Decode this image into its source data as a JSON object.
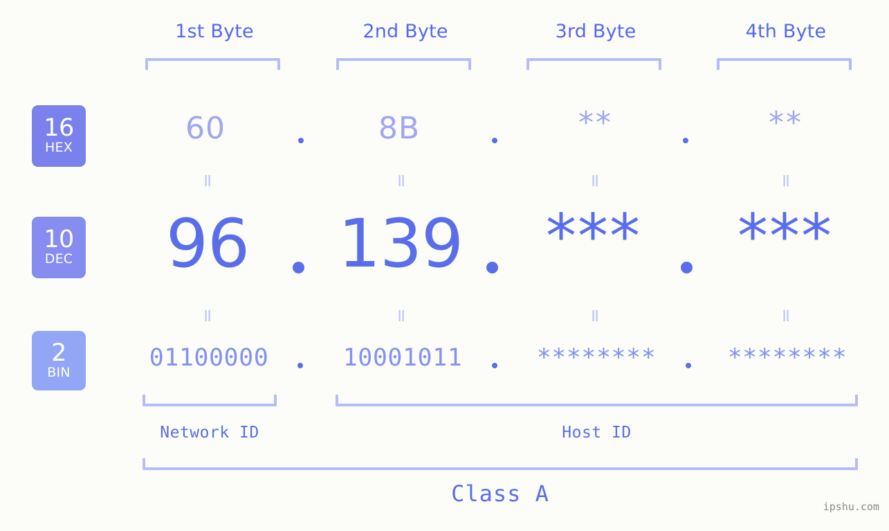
{
  "theme": {
    "background": "#fcfdf8",
    "accent_strong": "#5a6ee9",
    "accent_header": "#5468ea",
    "accent_hex": "#9fa7f0",
    "accent_bin": "#8491f1",
    "bracket": "#b6bdf6",
    "equals": "#bcc4f7",
    "badge_hex_bg": "#7b81ec",
    "badge_dec_bg": "#868cf0",
    "badge_bin_bg": "#93a5f5",
    "watermark_color": "#8a8a8a"
  },
  "headers": {
    "byte1": "1st Byte",
    "byte2": "2nd Byte",
    "byte3": "3rd Byte",
    "byte4": "4th Byte"
  },
  "bases": {
    "hex": {
      "number": "16",
      "label": "HEX"
    },
    "dec": {
      "number": "10",
      "label": "DEC"
    },
    "bin": {
      "number": "2",
      "label": "BIN"
    }
  },
  "rows": {
    "hex": {
      "byte1": "60",
      "byte2": "8B",
      "byte3": "**",
      "byte4": "**",
      "sep1": ".",
      "sep2": ".",
      "sep3": "."
    },
    "dec": {
      "byte1": "96",
      "byte2": "139",
      "byte3": "***",
      "byte4": "***",
      "sep1": ".",
      "sep2": ".",
      "sep3": "."
    },
    "bin": {
      "byte1": "01100000",
      "byte2": "10001011",
      "byte3": "********",
      "byte4": "********",
      "sep1": ".",
      "sep2": ".",
      "sep3": "."
    }
  },
  "equals_marks": {
    "hex_to_dec_1": "=",
    "hex_to_dec_2": "=",
    "hex_to_dec_3": "=",
    "hex_to_dec_4": "=",
    "dec_to_bin_1": "=",
    "dec_to_bin_2": "=",
    "dec_to_bin_3": "=",
    "dec_to_bin_4": "="
  },
  "segments": {
    "network_id": "Network ID",
    "host_id": "Host ID",
    "ip_class": "Class A"
  },
  "watermark": "ipshu.com",
  "chart_data": {
    "type": "table",
    "title": "IPv4 address byte breakdown",
    "columns": [
      "1st Byte",
      "2nd Byte",
      "3rd Byte",
      "4th Byte"
    ],
    "rows": [
      {
        "base": "16",
        "base_label": "HEX",
        "values": [
          "60",
          "8B",
          "**",
          "**"
        ]
      },
      {
        "base": "10",
        "base_label": "DEC",
        "values": [
          "96",
          "139",
          "***",
          "***"
        ]
      },
      {
        "base": "2",
        "base_label": "BIN",
        "values": [
          "01100000",
          "10001011",
          "********",
          "********"
        ]
      }
    ],
    "network_id_span": [
      "1st Byte"
    ],
    "host_id_span": [
      "2nd Byte",
      "3rd Byte",
      "4th Byte"
    ],
    "ip_class": "Class A"
  }
}
